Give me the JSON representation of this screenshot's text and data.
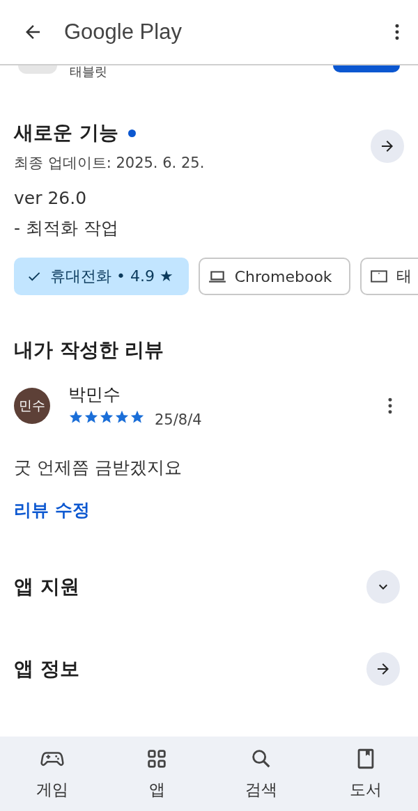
{
  "header": {
    "title": "Google Play"
  },
  "behind_row": {
    "text": "태블릿"
  },
  "whats_new": {
    "title": "새로운 기능",
    "updated": "최종 업데이트: 2025. 6. 25.",
    "lines": [
      "ver 26.0",
      "- 최적화 작업"
    ]
  },
  "devices": [
    {
      "label": "휴대전화 • 4.9 ★",
      "selected": true
    },
    {
      "kind": "laptop",
      "label": "Chromebook",
      "selected": false
    },
    {
      "kind": "tablet",
      "label": "태",
      "selected": false
    }
  ],
  "my_review": {
    "title": "내가 작성한 리뷰",
    "avatar": "민수",
    "name": "박민수",
    "stars": 5,
    "date": "25/8/4",
    "text": "굿 언제쯤 금받겠지요",
    "edit": "리뷰 수정"
  },
  "sections": [
    {
      "title": "앱 지원",
      "kind": "expand"
    },
    {
      "title": "앱 정보",
      "kind": "arrow"
    }
  ],
  "nav": [
    {
      "kind": "games",
      "label": "게임"
    },
    {
      "kind": "apps",
      "label": "앱"
    },
    {
      "kind": "search",
      "label": "검색"
    },
    {
      "kind": "books",
      "label": "도서"
    }
  ]
}
